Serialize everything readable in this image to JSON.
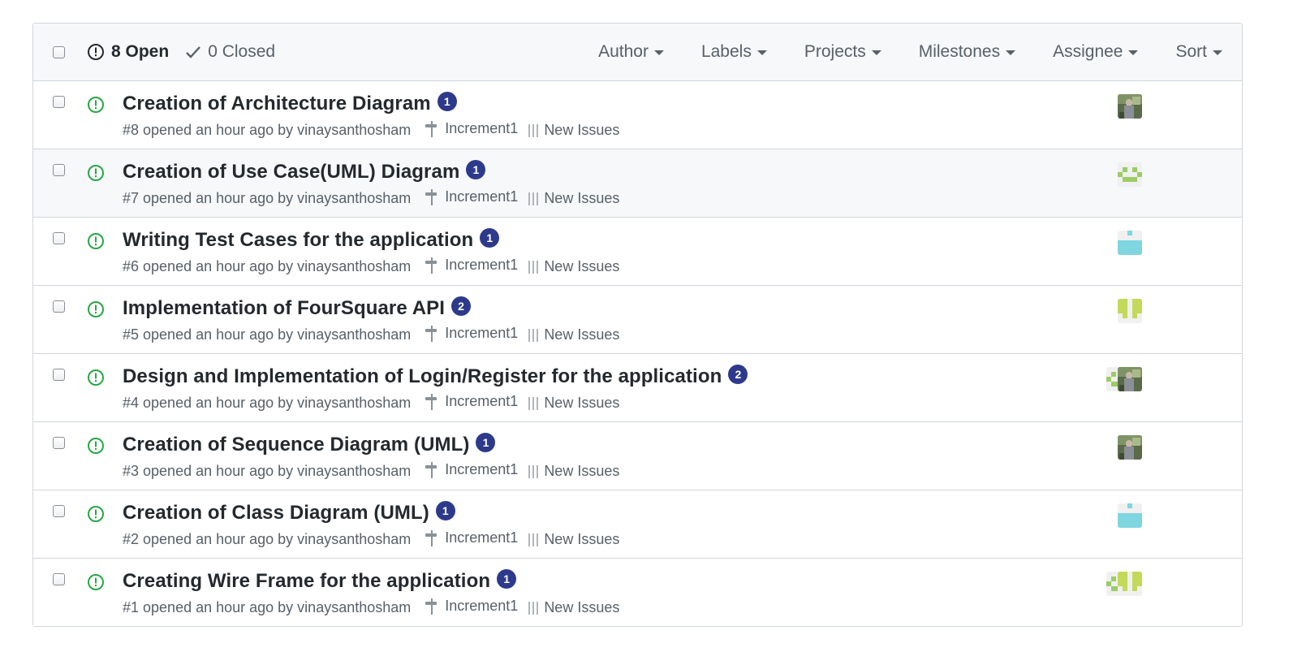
{
  "header": {
    "open_count_label": "8 Open",
    "closed_count_label": "0 Closed",
    "filters": [
      "Author",
      "Labels",
      "Projects",
      "Milestones",
      "Assignee",
      "Sort"
    ]
  },
  "colors": {
    "open_icon": "#28a745",
    "badge": "#2d3a8c",
    "header_bg": "#f6f8fa",
    "border": "#d1d5da",
    "meta_text": "#586069"
  },
  "issues": [
    {
      "title": "Creation of Architecture Diagram",
      "comments": "1",
      "meta": "#8 opened an hour ago by vinaysanthosham",
      "milestone": "Increment1",
      "project": "New Issues",
      "assignees": [
        "photo"
      ]
    },
    {
      "title": "Creation of Use Case(UML) Diagram",
      "comments": "1",
      "meta": "#7 opened an hour ago by vinaysanthosham",
      "milestone": "Increment1",
      "project": "New Issues",
      "assignees": [
        "identicon-green"
      ]
    },
    {
      "title": "Writing Test Cases for the application",
      "comments": "1",
      "meta": "#6 opened an hour ago by vinaysanthosham",
      "milestone": "Increment1",
      "project": "New Issues",
      "assignees": [
        "identicon-cyan"
      ]
    },
    {
      "title": "Implementation of FourSquare API",
      "comments": "2",
      "meta": "#5 opened an hour ago by vinaysanthosham",
      "milestone": "Increment1",
      "project": "New Issues",
      "assignees": [
        "identicon-lime"
      ]
    },
    {
      "title": "Design and Implementation of Login/Register for the application",
      "comments": "2",
      "meta": "#4 opened an hour ago by vinaysanthosham",
      "milestone": "Increment1",
      "project": "New Issues",
      "assignees": [
        "identicon-green",
        "photo"
      ]
    },
    {
      "title": "Creation of Sequence Diagram (UML)",
      "comments": "1",
      "meta": "#3 opened an hour ago by vinaysanthosham",
      "milestone": "Increment1",
      "project": "New Issues",
      "assignees": [
        "photo"
      ]
    },
    {
      "title": "Creation of Class Diagram (UML)",
      "comments": "1",
      "meta": "#2 opened an hour ago by vinaysanthosham",
      "milestone": "Increment1",
      "project": "New Issues",
      "assignees": [
        "identicon-cyan"
      ]
    },
    {
      "title": "Creating Wire Frame for the application",
      "comments": "1",
      "meta": "#1 opened an hour ago by vinaysanthosham",
      "milestone": "Increment1",
      "project": "New Issues",
      "assignees": [
        "identicon-green",
        "identicon-lime"
      ]
    }
  ]
}
